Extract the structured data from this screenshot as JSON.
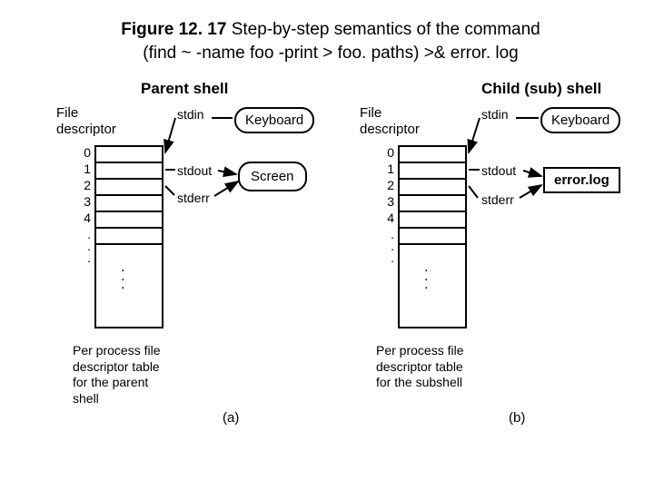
{
  "figure": {
    "number": "Figure 12. 17",
    "title_line1": "Step-by-step semantics of the command",
    "title_line2": "(find ~ -name foo -print > foo. paths) >& error. log"
  },
  "panelA": {
    "heading": "Parent shell",
    "file_descriptor_label_l1": "File",
    "file_descriptor_label_l2": "descriptor",
    "stdin": "stdin",
    "stdout": "stdout",
    "stderr": "stderr",
    "keyboard": "Keyboard",
    "screen": "Screen",
    "fd_numbers": [
      "0",
      "1",
      "2",
      "3",
      "4"
    ],
    "footer_l1": "Per process file",
    "footer_l2": "descriptor table",
    "footer_l3": "for the parent",
    "footer_l4": "shell",
    "tag": "(a)"
  },
  "panelB": {
    "heading": "Child (sub) shell",
    "file_descriptor_label_l1": "File",
    "file_descriptor_label_l2": "descriptor",
    "stdin": "stdin",
    "stdout": "stdout",
    "stderr": "stderr",
    "keyboard": "Keyboard",
    "errorlog": "error.log",
    "fd_numbers": [
      "0",
      "1",
      "2",
      "3",
      "4"
    ],
    "footer_l1": "Per process file",
    "footer_l2": "descriptor table",
    "footer_l3": "for the subshell",
    "tag": "(b)"
  }
}
